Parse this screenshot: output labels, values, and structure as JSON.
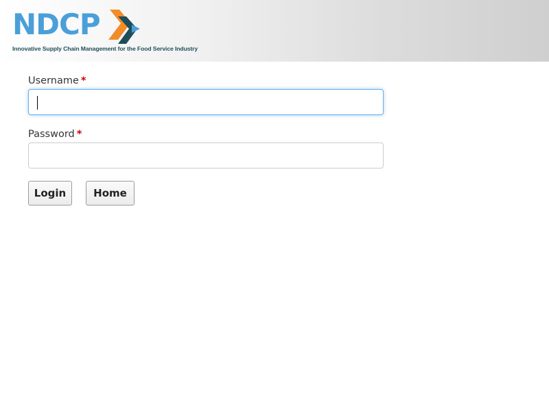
{
  "header": {
    "logo": {
      "text": "NDCP",
      "tagline": "Innovative Supply Chain Management for the Food Service Industry",
      "colors": {
        "letters": "#4a9fd9",
        "arrow_orange": "#f28c28",
        "arrow_dark": "#1f4e5a",
        "arrow_blue": "#4a9fd9"
      }
    }
  },
  "form": {
    "username": {
      "label": "Username",
      "required_mark": "*",
      "value": "",
      "focused": true
    },
    "password": {
      "label": "Password",
      "required_mark": "*",
      "value": ""
    },
    "buttons": {
      "login_label": "Login",
      "home_label": "Home"
    }
  },
  "colors": {
    "required": "#cc0000",
    "focus_border": "#66afe9"
  }
}
